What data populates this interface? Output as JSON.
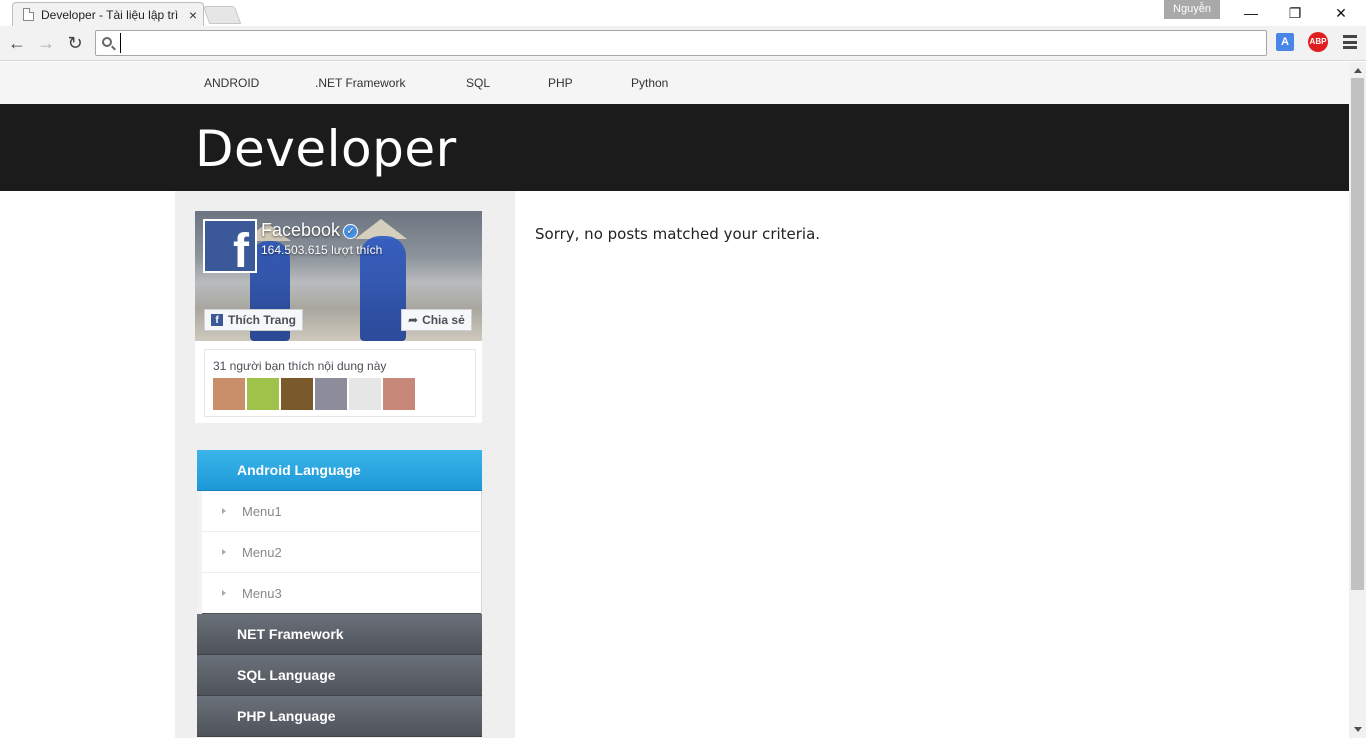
{
  "browser": {
    "tab_title": "Developer - Tài liệu lập trì",
    "tab_close": "×",
    "profile_name": "Nguyễn",
    "address_value": "",
    "window_minimize": "—",
    "window_restore": "❐",
    "window_close": "✕",
    "back": "←",
    "forward": "→",
    "reload": "↻",
    "ext_translate": "A",
    "ext_abp": "ABP"
  },
  "nav": {
    "items": [
      {
        "label": "ANDROID"
      },
      {
        "label": ".NET Framework"
      },
      {
        "label": "SQL"
      },
      {
        "label": "PHP"
      },
      {
        "label": "Python"
      }
    ]
  },
  "site": {
    "title": "Developer"
  },
  "facebook": {
    "logo_letter": "f",
    "page_name": "Facebook",
    "verified_mark": "✓",
    "likes": "164.503.615 lượt thích",
    "like_button": "Thích Trang",
    "share_button": "Chia sẻ",
    "friends_text": "31 người bạn thích nội dung này",
    "avatar_colors": [
      "#c98f6a",
      "#9fc24a",
      "#7a5a2a",
      "#8c8c9a",
      "#e6e6e6",
      "#c7887a"
    ]
  },
  "sidebar_menu": {
    "active_section": "Android Language",
    "sub_items": [
      {
        "label": "Menu1"
      },
      {
        "label": "Menu2"
      },
      {
        "label": "Menu3"
      }
    ],
    "sections": [
      {
        "label": "NET Framework"
      },
      {
        "label": "SQL Language"
      },
      {
        "label": "PHP Language"
      }
    ]
  },
  "content": {
    "message": "Sorry, no posts matched your criteria."
  },
  "colors": {
    "accent_blue": "#1c98d7",
    "header_dark": "#1b1b1b",
    "facebook_blue": "#3b5998"
  }
}
